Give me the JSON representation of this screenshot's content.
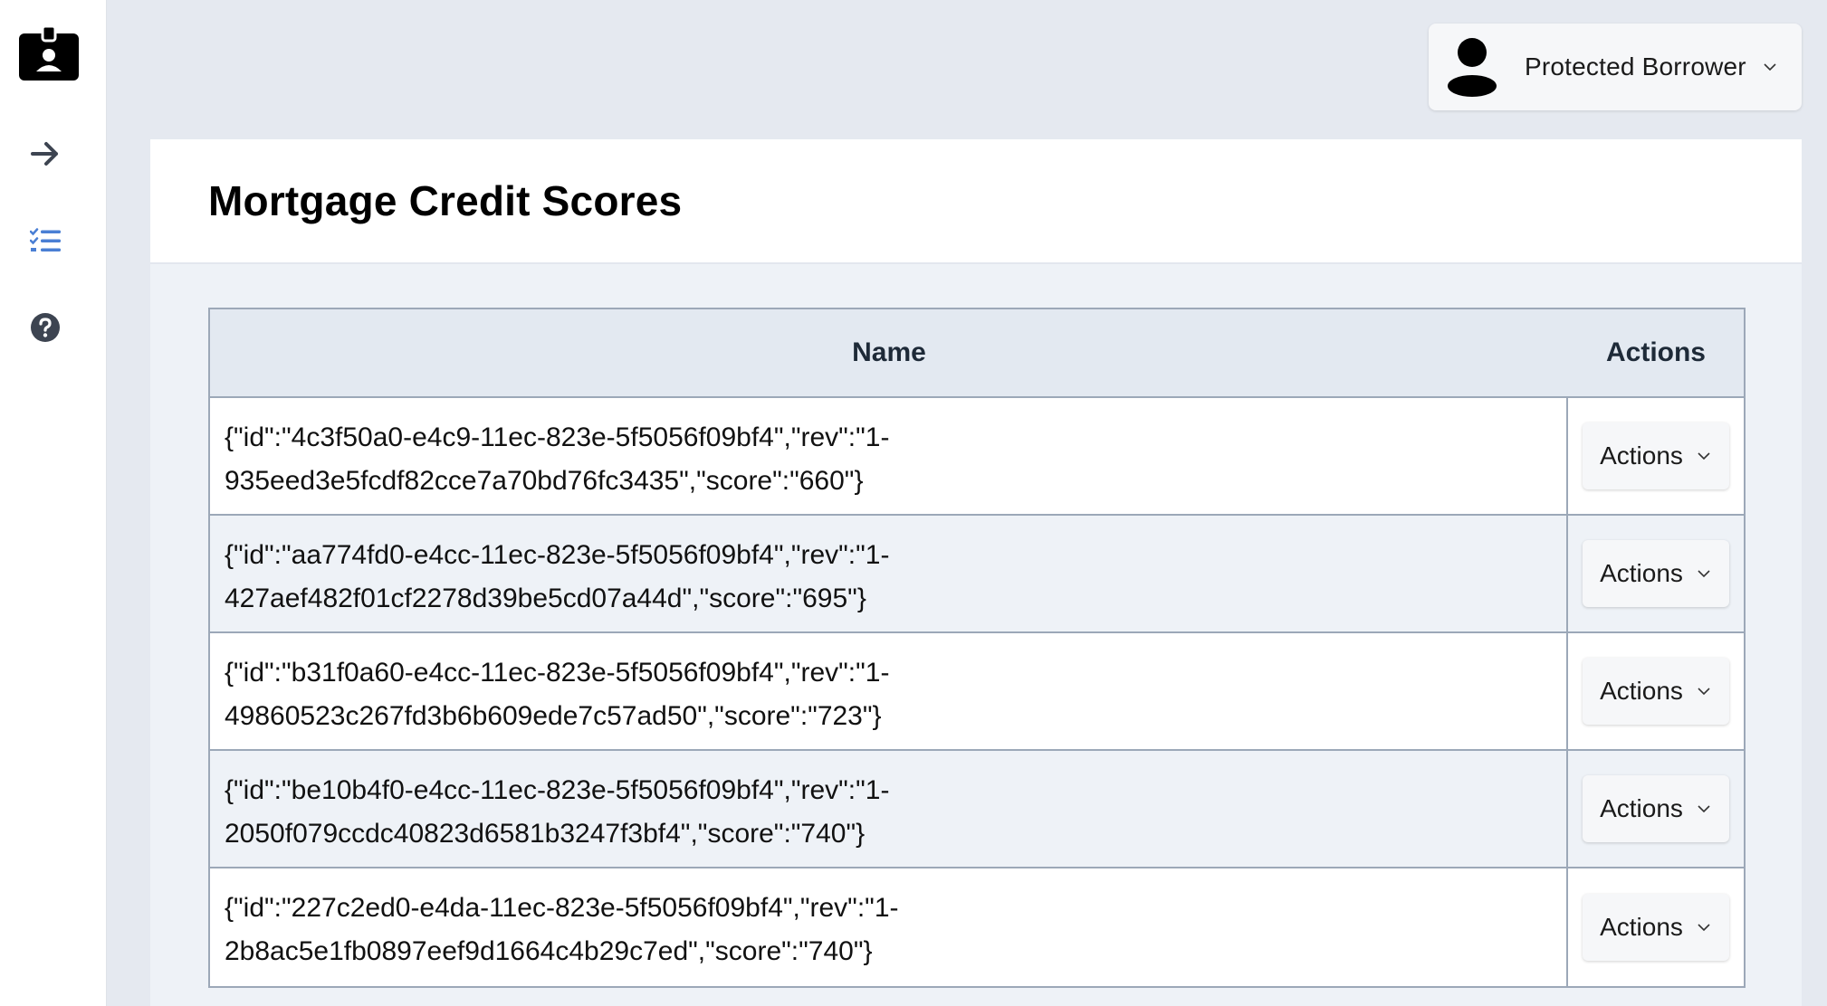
{
  "sidebar": {
    "items": [
      {
        "icon": "id-badge-icon"
      },
      {
        "icon": "arrow-right-icon"
      },
      {
        "icon": "task-list-icon"
      },
      {
        "icon": "help-circle-icon"
      }
    ]
  },
  "user_menu": {
    "name": "Protected Borrower",
    "icon": "user-avatar-icon"
  },
  "page": {
    "title": "Mortgage Credit Scores"
  },
  "table": {
    "columns": [
      "Name",
      "Actions"
    ],
    "rows": [
      {
        "line1": "{\"id\":\"4c3f50a0-e4c9-11ec-823e-5f5056f09bf4\",\"rev\":\"1-",
        "line2": "935eed3e5fcdf82cce7a70bd76fc3435\",\"score\":\"660\"}",
        "action": "Actions"
      },
      {
        "line1": "{\"id\":\"aa774fd0-e4cc-11ec-823e-5f5056f09bf4\",\"rev\":\"1-",
        "line2": "427aef482f01cf2278d39be5cd07a44d\",\"score\":\"695\"}",
        "action": "Actions"
      },
      {
        "line1": "{\"id\":\"b31f0a60-e4cc-11ec-823e-5f5056f09bf4\",\"rev\":\"1-",
        "line2": "49860523c267fd3b6b609ede7c57ad50\",\"score\":\"723\"}",
        "action": "Actions"
      },
      {
        "line1": "{\"id\":\"be10b4f0-e4cc-11ec-823e-5f5056f09bf4\",\"rev\":\"1-",
        "line2": "2050f079ccdc40823d6581b3247f3bf4\",\"score\":\"740\"}",
        "action": "Actions"
      },
      {
        "line1": "{\"id\":\"227c2ed0-e4da-11ec-823e-5f5056f09bf4\",\"rev\":\"1-",
        "line2": "2b8ac5e1fb0897eef9d1664c4b29c7ed\",\"score\":\"740\"}",
        "action": "Actions"
      }
    ]
  },
  "colors": {
    "accent": "#4a7fd4",
    "icon_dark": "#3d4451",
    "border": "#9ca8b8",
    "header_bg": "#e3e9f1"
  }
}
